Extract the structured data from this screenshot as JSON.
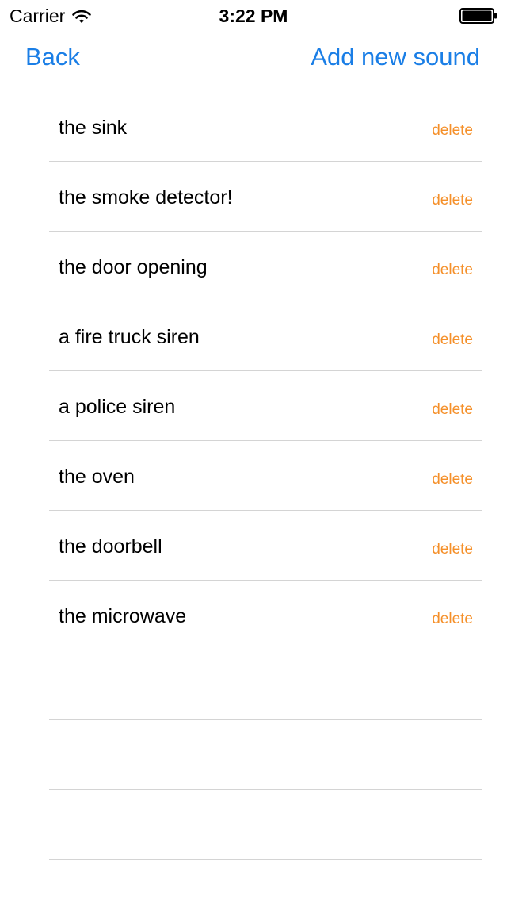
{
  "status_bar": {
    "carrier": "Carrier",
    "time": "3:22 PM"
  },
  "nav": {
    "back_label": "Back",
    "add_label": "Add new sound",
    "accent_color": "#1a7ee6"
  },
  "sounds": [
    {
      "label": "the sink",
      "action": "delete"
    },
    {
      "label": "the smoke detector!",
      "action": "delete"
    },
    {
      "label": "the door opening",
      "action": "delete"
    },
    {
      "label": "a fire truck siren",
      "action": "delete"
    },
    {
      "label": "a police siren",
      "action": "delete"
    },
    {
      "label": "the oven",
      "action": "delete"
    },
    {
      "label": "the doorbell",
      "action": "delete"
    },
    {
      "label": "the microwave",
      "action": "delete"
    }
  ],
  "delete_color": "#f5902a",
  "icons": {
    "wifi": "wifi-icon",
    "battery": "battery-icon"
  }
}
